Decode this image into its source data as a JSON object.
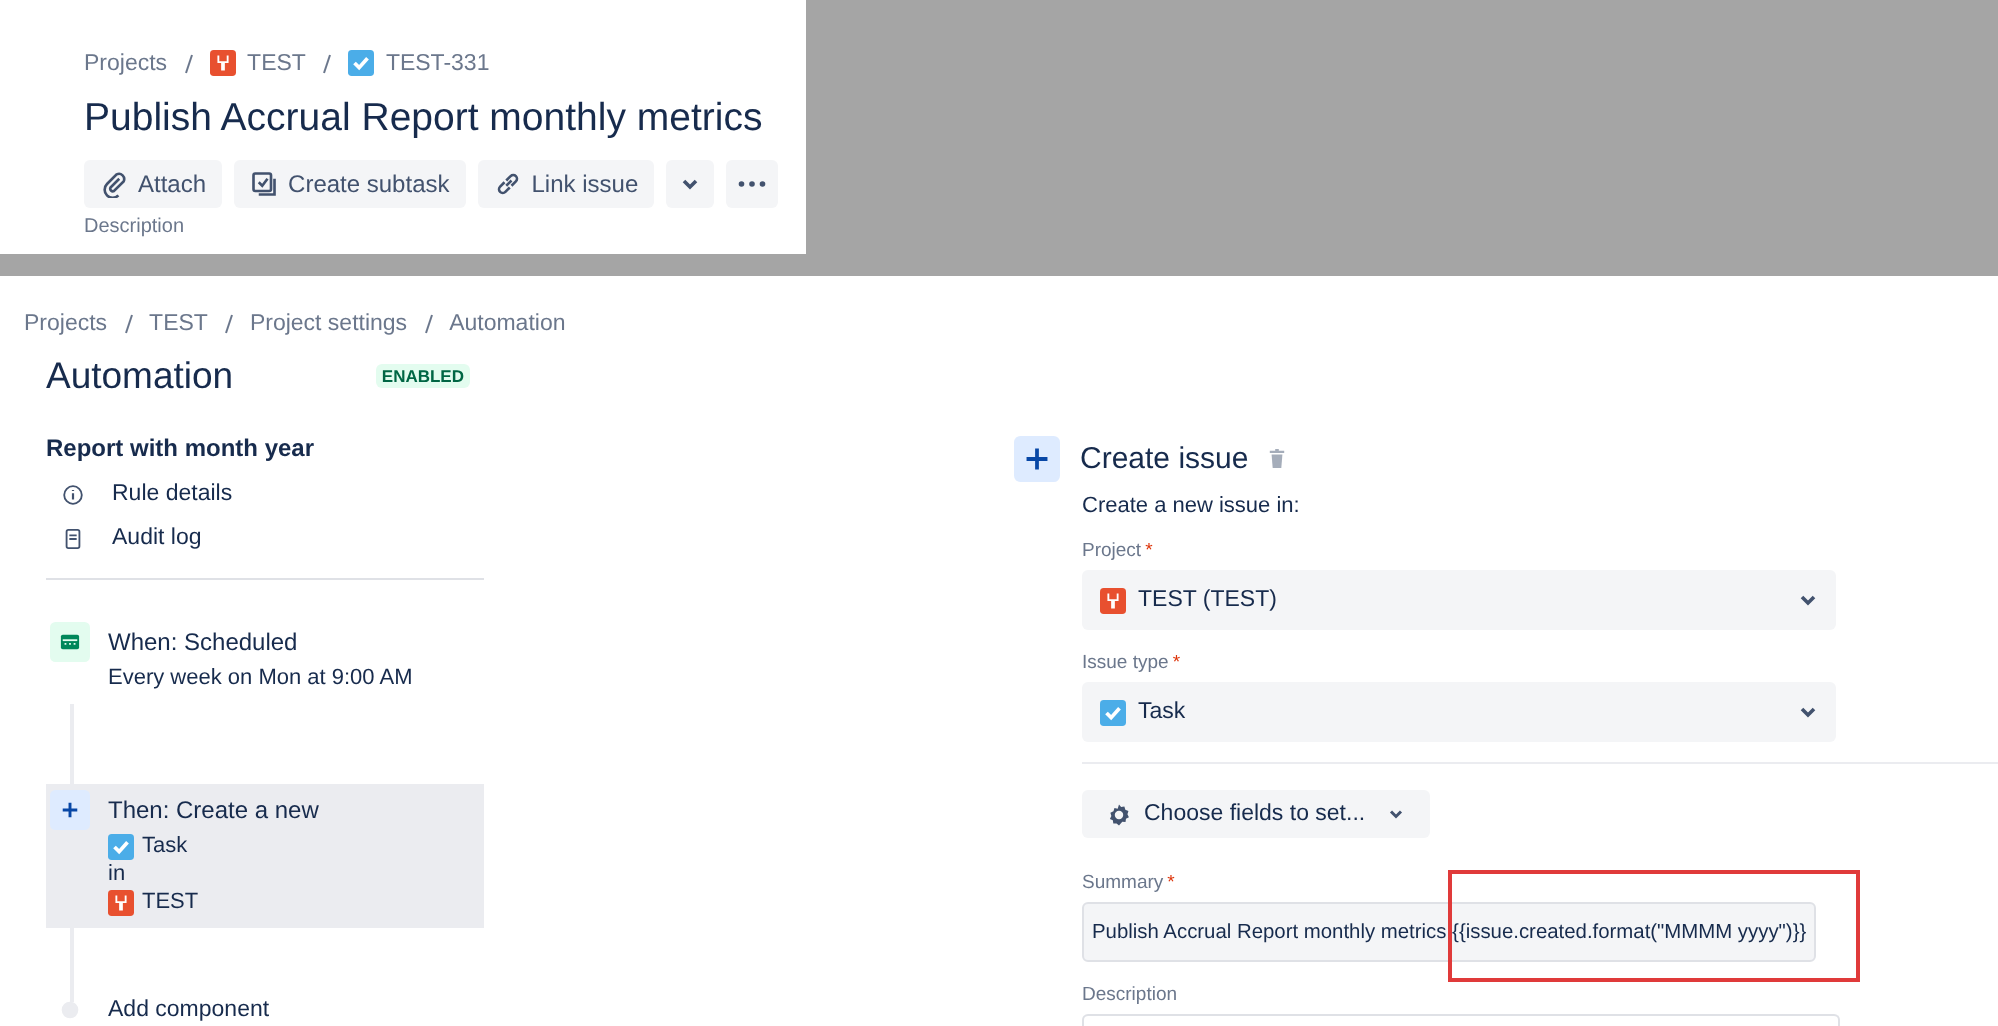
{
  "issue_header": {
    "breadcrumbs": [
      {
        "label": "Projects",
        "kind": "text"
      },
      {
        "label": "TEST",
        "kind": "project"
      },
      {
        "label": "TEST-331",
        "kind": "task"
      }
    ],
    "title": "Publish Accrual Report monthly metrics",
    "actions": [
      {
        "label": "Attach",
        "kind": "attach"
      },
      {
        "label": "Create subtask",
        "kind": "subtask"
      },
      {
        "label": "Link issue",
        "kind": "link"
      }
    ],
    "section_label": "Description"
  },
  "automation": {
    "breadcrumbs": [
      "Projects",
      "TEST",
      "Project settings",
      "Automation"
    ],
    "title": "Automation",
    "status": "ENABLED",
    "rule_name": "Report with month year",
    "nav": [
      {
        "label": "Rule details",
        "kind": "info"
      },
      {
        "label": "Audit log",
        "kind": "log"
      }
    ],
    "components": [
      {
        "kind": "trigger",
        "title": "When: Scheduled",
        "selected": false,
        "lines": [
          {
            "kind": "plain",
            "text": "Every week on Mon at 9:00 AM"
          }
        ]
      },
      {
        "kind": "action",
        "title": "Then: Create a new",
        "selected": true,
        "lines": [
          {
            "kind": "task",
            "text": "Task"
          },
          {
            "kind": "plain",
            "text": "in"
          },
          {
            "kind": "project",
            "text": "TEST"
          }
        ]
      }
    ],
    "add_component": "Add component"
  },
  "editor": {
    "title": "Create issue",
    "intro": "Create a new issue in:",
    "project": {
      "label": "Project",
      "required_mark": "*",
      "value": "TEST (TEST)",
      "kind": "project"
    },
    "issue_type": {
      "label": "Issue type",
      "required_mark": "*",
      "value": "Task",
      "kind": "task"
    },
    "choose_fields": "Choose fields to set...",
    "summary": {
      "label": "Summary",
      "required_mark": "*",
      "value": "Publish Accrual Report monthly metrics {{issue.created.format(\"MMMM yyyy\")}}",
      "highlighted": true
    },
    "description": {
      "label": "Description"
    }
  }
}
